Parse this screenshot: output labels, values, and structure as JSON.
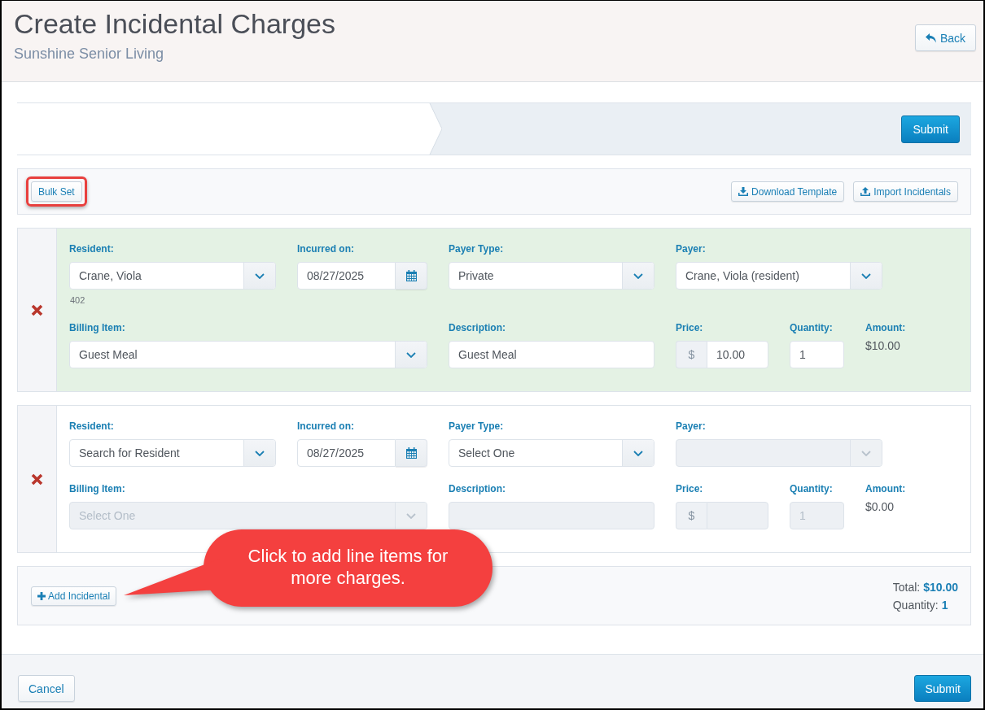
{
  "header": {
    "title": "Create Incidental Charges",
    "subtitle": "Sunshine Senior Living",
    "back_button": {
      "label": "Back"
    }
  },
  "wizard": {
    "submit_button": {
      "label": "Submit"
    }
  },
  "toolbar": {
    "buttons": [
      {
        "kind": "bulk",
        "label": "Bulk Set",
        "highlighted": true
      },
      {
        "kind": "download",
        "label": "Download Template",
        "highlighted": false
      },
      {
        "kind": "upload",
        "label": "Import Incidentals",
        "highlighted": false
      }
    ]
  },
  "charges": [
    {
      "valid": true,
      "lines": [
        {
          "fields": [
            {
              "kind": "select",
              "label": "Resident:",
              "value": "Crane, Viola",
              "note": "402",
              "disabled": false
            },
            {
              "kind": "date",
              "label": "Incurred on:",
              "value": "08/27/2025",
              "disabled": false
            },
            {
              "kind": "select",
              "label": "Payer Type:",
              "value": "Private",
              "disabled": false
            },
            {
              "kind": "select",
              "label": "Payer:",
              "value": "Crane, Viola (resident)",
              "disabled": false
            }
          ]
        },
        {
          "fields": [
            {
              "kind": "select",
              "label": "Billing Item:",
              "value": "Guest Meal",
              "disabled": false
            },
            {
              "kind": "text",
              "label": "Description:",
              "value": "Guest Meal",
              "disabled": false
            },
            {
              "kind": "price",
              "label": "Price:",
              "currency": "$",
              "value": "10.00",
              "disabled": false
            },
            {
              "kind": "number",
              "label": "Quantity:",
              "value": "1",
              "disabled": false
            }
          ]
        }
      ],
      "amount": {
        "label": "Amount:",
        "value": "$10.00"
      }
    },
    {
      "valid": false,
      "lines": [
        {
          "fields": [
            {
              "kind": "select",
              "label": "Resident:",
              "placeholder": "Search for Resident",
              "disabled": false
            },
            {
              "kind": "date",
              "label": "Incurred on:",
              "value": "08/27/2025",
              "disabled": false
            },
            {
              "kind": "select",
              "label": "Payer Type:",
              "placeholder": "Select One",
              "disabled": false
            },
            {
              "kind": "select",
              "label": "Payer:",
              "disabled": true
            }
          ]
        },
        {
          "fields": [
            {
              "kind": "select",
              "label": "Billing Item:",
              "placeholder": "Select One",
              "disabled": true
            },
            {
              "kind": "text",
              "label": "Description:",
              "disabled": true
            },
            {
              "kind": "price",
              "label": "Price:",
              "currency": "$",
              "disabled": true
            },
            {
              "kind": "number",
              "label": "Quantity:",
              "value": "1",
              "disabled": true
            }
          ]
        }
      ],
      "amount": {
        "label": "Amount:",
        "value": "$0.00"
      }
    }
  ],
  "summary": {
    "add_button": {
      "label": "Add Incidental"
    },
    "totals": [
      {
        "label": "Total:",
        "value": "$10.00"
      },
      {
        "label": "Quantity:",
        "value": "1"
      }
    ]
  },
  "callout": {
    "text": "Click to add line items for more charges."
  },
  "footer": {
    "cancel_button": {
      "label": "Cancel"
    },
    "submit_button": {
      "label": "Submit"
    }
  }
}
